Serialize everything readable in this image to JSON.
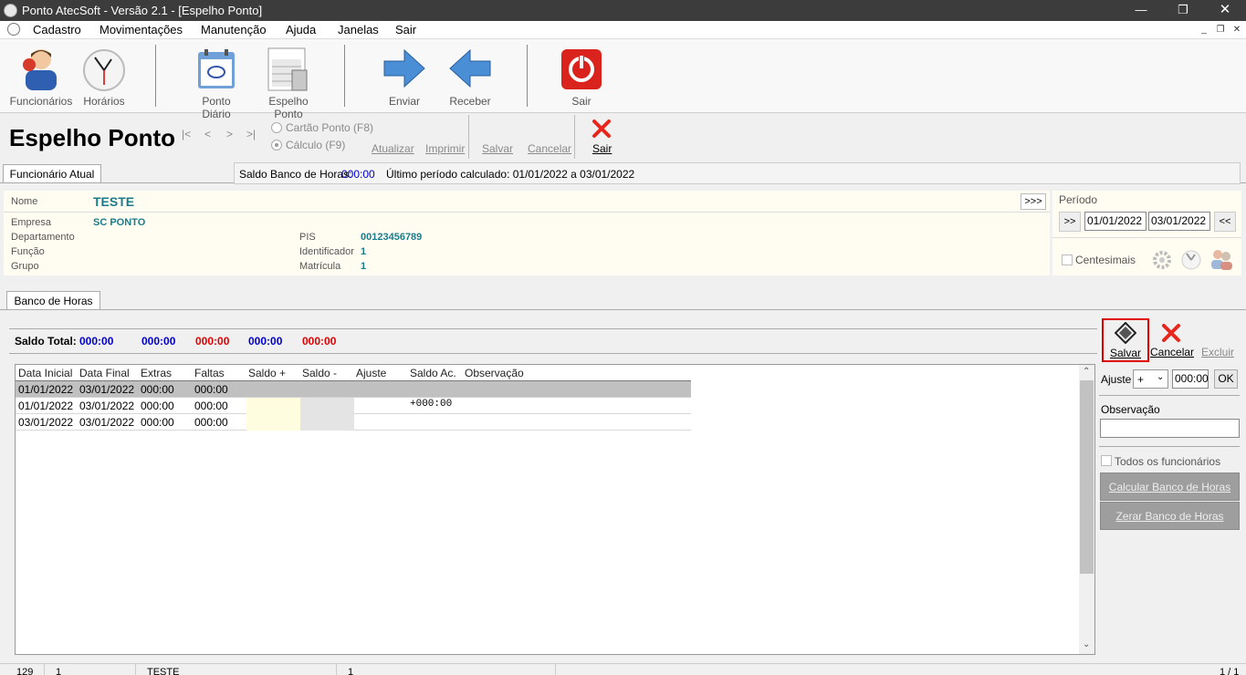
{
  "window": {
    "title": "Ponto AtecSoft - Versão 2.1 - [Espelho Ponto]"
  },
  "menu": [
    "Cadastro",
    "Movimentações",
    "Manutenção",
    "Ajuda",
    "Janelas",
    "Sair"
  ],
  "toolbar": {
    "funcionarios": "Funcionários",
    "horarios": "Horários",
    "ponto_diario": "Ponto Diário",
    "espelho_ponto": "Espelho Ponto",
    "enviar": "Enviar",
    "receber": "Receber",
    "sair": "Sair"
  },
  "form": {
    "title": "Espelho Ponto",
    "radio_cartao": "Cartão Ponto (F8)",
    "radio_calculo": "Cálculo (F9)",
    "atualizar": "Atualizar",
    "imprimir": "Imprimir",
    "salvar": "Salvar",
    "cancelar": "Cancelar",
    "sair": "Sair"
  },
  "status": {
    "tab": "Funcionário Atual",
    "saldo_label": "Saldo Banco de Horas:",
    "saldo_value": "000:00",
    "periodo_calc": "Último período calculado: 01/01/2022 a 03/01/2022"
  },
  "employee": {
    "nome_label": "Nome",
    "nome": "TESTE",
    "expand": ">>>",
    "empresa_label": "Empresa",
    "empresa": "SC PONTO",
    "departamento_label": "Departamento",
    "funcao_label": "Função",
    "grupo_label": "Grupo",
    "pis_label": "PIS",
    "pis": "00123456789",
    "identificador_label": "Identificador",
    "identificador": "1",
    "matricula_label": "Matrícula",
    "matricula": "1"
  },
  "periodo": {
    "label": "Período",
    "prev": ">>",
    "start": "01/01/2022",
    "end": "03/01/2022",
    "next": "<<",
    "centesimais": "Centesimais"
  },
  "banco": {
    "tab": "Banco de Horas",
    "saldo_total_label": "Saldo Total:",
    "totals": [
      "000:00",
      "000:00",
      "000:00",
      "000:00",
      "000:00"
    ],
    "columns": [
      "Data Inicial",
      "Data Final",
      "Extras",
      "Faltas",
      "Saldo +",
      "Saldo -",
      "Ajuste",
      "Saldo Ac.",
      "Observação"
    ],
    "rows": [
      [
        "01/01/2022",
        "03/01/2022",
        "000:00",
        "000:00",
        "",
        "",
        "",
        "",
        ""
      ],
      [
        "01/01/2022",
        "03/01/2022",
        "000:00",
        "000:00",
        "",
        "",
        "",
        "+000:00",
        ""
      ],
      [
        "03/01/2022",
        "03/01/2022",
        "000:00",
        "000:00",
        "",
        "",
        "",
        "",
        ""
      ]
    ]
  },
  "side": {
    "salvar": "Salvar",
    "cancelar": "Cancelar",
    "excluir": "Excluir",
    "ajuste_label": "Ajuste",
    "ajuste_sign": "+",
    "ajuste_value": "000:00",
    "ok": "OK",
    "observacao_label": "Observação",
    "todos": "Todos os funcionários",
    "calcular": "Calcular Banco de Horas",
    "zerar": "Zerar Banco de Horas"
  },
  "footer": [
    "129",
    "1",
    "TESTE",
    "1",
    "1 / 1"
  ],
  "colors": {
    "blue": "#0000cc",
    "red": "#e00000",
    "teal": "#1a7c8a",
    "highlight": "#e00000"
  }
}
